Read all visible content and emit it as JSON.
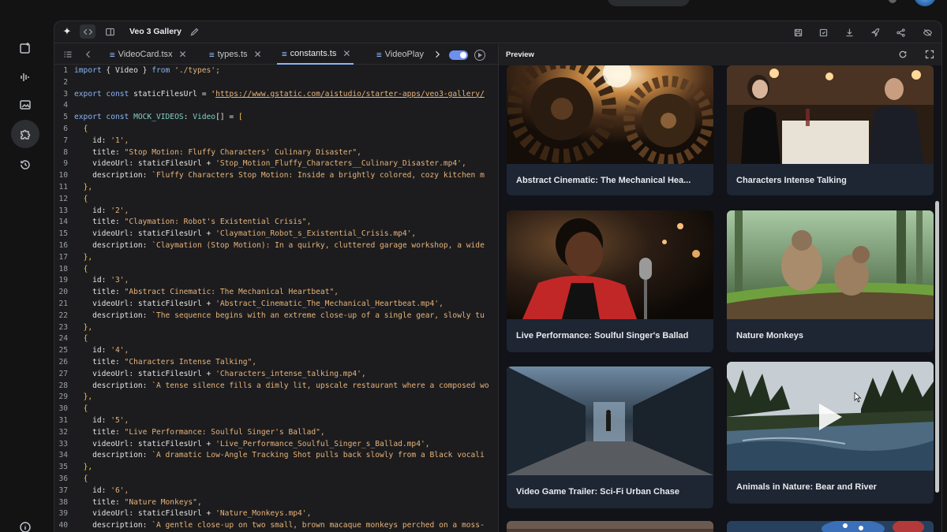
{
  "app": {
    "project_title": "Veo 3 Gallery"
  },
  "editor": {
    "tabs": [
      {
        "label": "VideoCard.tsx",
        "close": "✕"
      },
      {
        "label": "types.ts",
        "close": "✕"
      },
      {
        "label": "constants.ts",
        "close": "✕"
      },
      {
        "label": "VideoPlay"
      }
    ],
    "active_tab": "constants.ts",
    "lines": [
      {
        "n": "1"
      },
      {
        "n": "2"
      },
      {
        "n": "3"
      },
      {
        "n": "4"
      },
      {
        "n": "5"
      },
      {
        "n": "6"
      },
      {
        "n": "7"
      },
      {
        "n": "8"
      },
      {
        "n": "9"
      },
      {
        "n": "10"
      },
      {
        "n": "11"
      },
      {
        "n": "12"
      },
      {
        "n": "13"
      },
      {
        "n": "14"
      },
      {
        "n": "15"
      },
      {
        "n": "16"
      },
      {
        "n": "17"
      },
      {
        "n": "18"
      },
      {
        "n": "19"
      },
      {
        "n": "20"
      },
      {
        "n": "21"
      },
      {
        "n": "22"
      },
      {
        "n": "23"
      },
      {
        "n": "24"
      },
      {
        "n": "25"
      },
      {
        "n": "26"
      },
      {
        "n": "27"
      },
      {
        "n": "28"
      },
      {
        "n": "29"
      },
      {
        "n": "30"
      },
      {
        "n": "31"
      },
      {
        "n": "32"
      },
      {
        "n": "33"
      },
      {
        "n": "34"
      },
      {
        "n": "35"
      },
      {
        "n": "36"
      },
      {
        "n": "37"
      },
      {
        "n": "38"
      },
      {
        "n": "39"
      },
      {
        "n": "40"
      }
    ],
    "code": {
      "import_kw": "import",
      "import_body": " { Video } ",
      "from_kw": "from",
      "import_path": " './types';",
      "export_kw": "export const",
      "url_name": " staticFilesUrl = '",
      "url_value": "https://www.gstatic.com/aistudio/starter-apps/veo3-gallery/",
      "mock_name": " MOCK_VIDEOS",
      "mock_colon": ": ",
      "mock_type": "Video",
      "mock_rest": "[] = ",
      "open_bracket": "[",
      "open_brace": "{",
      "close_brace": "},",
      "id_key": "id: ",
      "title_key": "title: ",
      "url_key": "videoUrl: staticFilesUrl + ",
      "desc_key": "description: ",
      "videos": [
        {
          "id": "'1',",
          "title": "\"Stop Motion: Fluffy Characters' Culinary Disaster\",",
          "file": "'Stop_Motion_Fluffy_Characters__Culinary_Disaster.mp4',",
          "desc": "`Fluffy Characters Stop Motion: Inside a brightly colored, cozy kitchen m"
        },
        {
          "id": "'2',",
          "title": "\"Claymation: Robot's Existential Crisis\",",
          "file": "'Claymation_Robot_s_Existential_Crisis.mp4',",
          "desc": "`Claymation (Stop Motion): In a quirky, cluttered garage workshop, a wide"
        },
        {
          "id": "'3',",
          "title": "\"Abstract Cinematic: The Mechanical Heartbeat\",",
          "file": "'Abstract_Cinematic_The_Mechanical_Heartbeat.mp4',",
          "desc": "`The sequence begins with an extreme close-up of a single gear, slowly tu"
        },
        {
          "id": "'4',",
          "title": "\"Characters Intense Talking\",",
          "file": "'Characters_intense_talking.mp4',",
          "desc": "`A tense silence fills a dimly lit, upscale restaurant where a composed wo"
        },
        {
          "id": "'5',",
          "title": "\"Live Performance: Soulful Singer's Ballad\",",
          "file": "'Live_Performance_Soulful_Singer_s_Ballad.mp4',",
          "desc": "`A dramatic Low-Angle Tracking Shot pulls back slowly from a Black vocali"
        },
        {
          "id": "'6',",
          "title": "\"Nature Monkeys\",",
          "file": "'Nature_Monkeys.mp4',",
          "desc": "`A gentle close-up on two small, brown macaque monkeys perched on a moss-"
        }
      ]
    }
  },
  "preview": {
    "title": "Preview",
    "cards": [
      {
        "caption": "Abstract Cinematic: The Mechanical Hea...",
        "scene": "gears"
      },
      {
        "caption": "Characters Intense Talking",
        "scene": "restaurant"
      },
      {
        "caption": "Live Performance: Soulful Singer's Ballad",
        "scene": "singer"
      },
      {
        "caption": "Nature Monkeys",
        "scene": "monkeys"
      },
      {
        "caption": "Video Game Trailer: Sci-Fi Urban Chase",
        "scene": "scifi"
      },
      {
        "caption": "Animals in Nature: Bear and River",
        "scene": "river"
      }
    ]
  },
  "colors": {
    "accent": "#8ab4f8",
    "toggle": "#6d8ff0",
    "card_bg": "#1e2533",
    "string": "#e6b37a",
    "type": "#7fd1c5"
  },
  "icons": {
    "rail": [
      "new-chat-icon",
      "audio-waveform-icon",
      "image-gallery-icon",
      "build-puzzle-icon",
      "history-icon",
      "info-icon"
    ],
    "toolbar": [
      "save-icon",
      "save-as-icon",
      "download-icon",
      "deploy-rocket-icon",
      "share-icon",
      "hide-eye-icon"
    ],
    "preview": [
      "refresh-icon",
      "fullscreen-icon"
    ]
  }
}
